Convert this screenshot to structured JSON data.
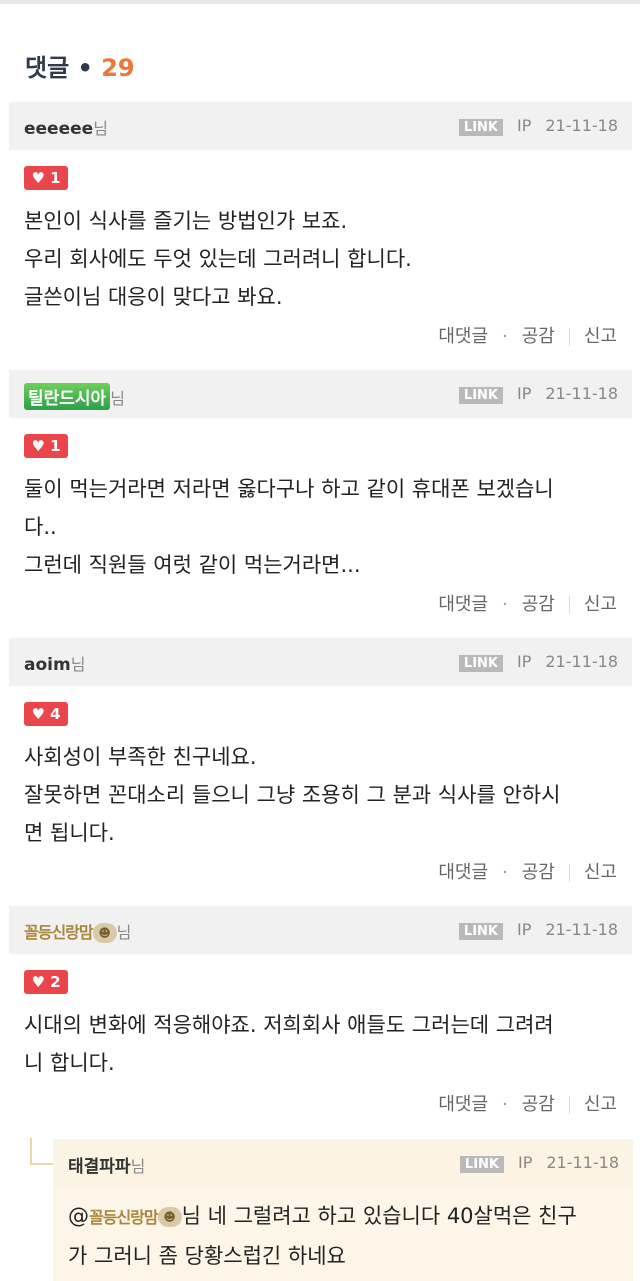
{
  "header": {
    "title": "댓글",
    "bullet": "•",
    "count": "29"
  },
  "comments": [
    {
      "username": "eeeeee",
      "suffix": "님",
      "link": "LINK",
      "ip": "IP",
      "date": "21-11-18",
      "likes": "1",
      "lines": [
        "본인이 식사를 즐기는 방법인가 보죠.",
        "우리 회사에도 두엇 있는데 그러려니 합니다.",
        "글쓴이님 대응이 맞다고 봐요."
      ],
      "actions": {
        "reply": "대댓글",
        "dot": "·",
        "like": "공감",
        "report": "신고"
      }
    },
    {
      "username": "틸란드시아",
      "suffix": "님",
      "link": "LINK",
      "ip": "IP",
      "date": "21-11-18",
      "likes": "1",
      "lines": [
        "둘이 먹는거라면 저라면 옳다구나 하고 같이 휴대폰 보겠습니",
        "다..",
        "그런데 직원들 여럿 같이 먹는거라면..."
      ],
      "actions": {
        "reply": "대댓글",
        "dot": "·",
        "like": "공감",
        "report": "신고"
      }
    },
    {
      "username": "aoim",
      "suffix": "님",
      "link": "LINK",
      "ip": "IP",
      "date": "21-11-18",
      "likes": "4",
      "lines": [
        "사회성이 부족한 친구네요.",
        "잘못하면 꼰대소리 들으니 그냥 조용히 그 분과 식사를 안하시",
        "면 됩니다."
      ],
      "actions": {
        "reply": "대댓글",
        "dot": "·",
        "like": "공감",
        "report": "신고"
      }
    },
    {
      "username": "꼴등신랑맘",
      "suffix": "님",
      "link": "LINK",
      "ip": "IP",
      "date": "21-11-18",
      "likes": "2",
      "lines": [
        "시대의 변화에 적응해야죠. 저희회사 애들도 그러는데 그려려",
        "니 합니다."
      ],
      "actions": {
        "reply": "대댓글",
        "dot": "·",
        "like": "공감",
        "report": "신고"
      }
    }
  ],
  "reply": {
    "username": "태결파파",
    "suffix": "님",
    "link": "LINK",
    "ip": "IP",
    "date": "21-11-18",
    "mention_at": "@",
    "mention_name": "꼴등신랑맘",
    "line1_rest": "님 네 그럴려고 하고 있습니다 40살먹은 친구",
    "line2": "가 그러니 좀 당황스럽긴 하네요"
  },
  "colors": {
    "like_badge": "#e9454b",
    "count": "#ee7733",
    "header_bg": "#f1f1f1",
    "reply_bg": "#fdf6e8"
  },
  "icons": {
    "heart": "heart-icon",
    "skull": "skull-icon"
  }
}
